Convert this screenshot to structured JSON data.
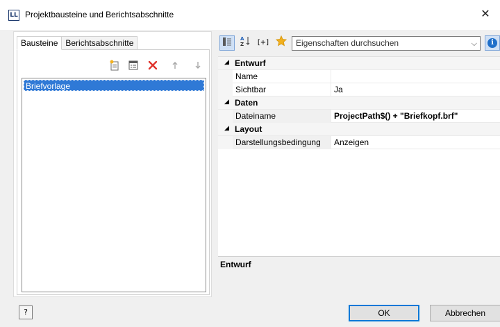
{
  "window": {
    "title": "Projektbausteine und Berichtsabschnitte",
    "app_icon": "LL",
    "close": "✕"
  },
  "left": {
    "tabs": [
      {
        "label": "Bausteine"
      },
      {
        "label": "Berichtsabschnitte"
      }
    ],
    "toolbar": {
      "new": "new-icon",
      "properties": "properties-icon",
      "delete": "delete-icon",
      "up": "arrow-up-icon",
      "down": "arrow-down-icon"
    },
    "items": [
      {
        "label": "Briefvorlage"
      }
    ]
  },
  "right": {
    "search": {
      "placeholder": "Eigenschaften durchsuchen"
    },
    "sections": [
      {
        "title": "Entwurf",
        "props": [
          {
            "name": "Name",
            "value": ""
          },
          {
            "name": "Sichtbar",
            "value": "Ja"
          }
        ]
      },
      {
        "title": "Daten",
        "props": [
          {
            "name": "Dateiname",
            "value": "ProjectPath$() + \"Briefkopf.brf\""
          }
        ]
      },
      {
        "title": "Layout",
        "props": [
          {
            "name": "Darstellungsbedingung",
            "value": "Anzeigen"
          }
        ]
      }
    ],
    "description_title": "Entwurf"
  },
  "buttons": {
    "ok": "OK",
    "cancel": "Abbrechen",
    "help": "?"
  },
  "colors": {
    "selection": "#2f79d6",
    "accent": "#0078d7",
    "delete": "#e0322b",
    "star": "#f2b01e"
  }
}
